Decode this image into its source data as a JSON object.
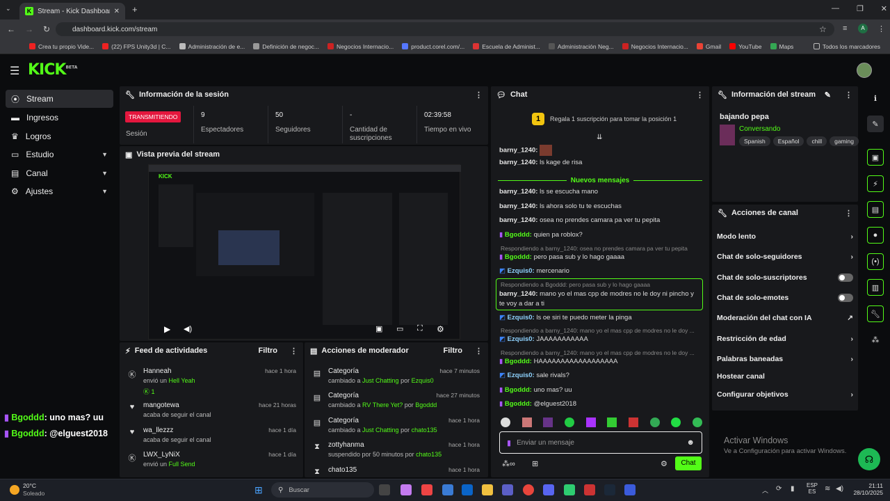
{
  "browser": {
    "tab_title": "Stream - Kick Dashboard",
    "url": "dashboard.kick.com/stream",
    "bookmarks": [
      "Crea tu propio Vide...",
      "(22) FPS Unity3d | C...",
      "Administración de e...",
      "Definición de negoc...",
      "Negocios Internacio...",
      "product.corel.com/...",
      "Escuela de Administ...",
      "Administración Neg...",
      "Negocios Internacio...",
      "Gmail",
      "YouTube",
      "Maps"
    ],
    "all_bookmarks": "Todos los marcadores",
    "profile_initial": "A"
  },
  "app": {
    "logo": "KICK",
    "logo_badge": "BETA"
  },
  "nav": [
    {
      "label": "Stream",
      "icon": "stream-icon",
      "active": true
    },
    {
      "label": "Ingresos",
      "icon": "money-icon"
    },
    {
      "label": "Logros",
      "icon": "trophy-icon"
    },
    {
      "label": "Estudio",
      "icon": "studio-icon",
      "expandable": true
    },
    {
      "label": "Canal",
      "icon": "channel-icon",
      "expandable": true
    },
    {
      "label": "Ajustes",
      "icon": "gear-icon",
      "expandable": true
    }
  ],
  "overlay_chat": [
    {
      "user": "Bgoddd",
      "text": ": uno mas? uu"
    },
    {
      "user": "Bgoddd",
      "text": ": @elguest2018"
    }
  ],
  "session": {
    "title": "Información de la sesión",
    "status_badge": "TRANSMITIENDO",
    "status_label": "Sesión",
    "stats": [
      {
        "value": "9",
        "label": "Espectadores"
      },
      {
        "value": "50",
        "label": "Seguidores"
      },
      {
        "value": "-",
        "label": "Cantidad de suscripciones"
      },
      {
        "value": "02:39:58",
        "label": "Tiempo en vivo"
      }
    ]
  },
  "preview": {
    "title": "Vista previa del stream"
  },
  "feed": {
    "title": "Feed de actividades",
    "filter": "Filtro",
    "items": [
      {
        "name": "Hanneah",
        "sub_pre": "envió un ",
        "sub_hl": "Hell Yeah",
        "extra": "1",
        "time": "hace 1 hora",
        "icon": "kick-coin-icon"
      },
      {
        "name": "mangotewa",
        "sub_pre": "acaba de seguir el canal",
        "sub_hl": "",
        "time": "hace 21 horas",
        "icon": "heart-icon"
      },
      {
        "name": "wa_llezzz",
        "sub_pre": "acaba de seguir el canal",
        "sub_hl": "",
        "time": "hace 1 día",
        "icon": "heart-icon"
      },
      {
        "name": "LWX_LyNiX",
        "sub_pre": "envió un ",
        "sub_hl": "Full Send",
        "time": "hace 1 día",
        "icon": "kick-coin-icon"
      }
    ]
  },
  "modactions": {
    "title": "Acciones de moderador",
    "filter": "Filtro",
    "items": [
      {
        "name": "Categoría",
        "pre": "cambiado a ",
        "hl": "Just Chatting",
        "mid": " por ",
        "by": "Ezquis0",
        "time": "hace 7 minutos"
      },
      {
        "name": "Categoría",
        "pre": "cambiado a ",
        "hl": "RV There Yet?",
        "mid": " por ",
        "by": "Bgoddd",
        "time": "hace 27 minutos"
      },
      {
        "name": "Categoría",
        "pre": "cambiado a ",
        "hl": "Just Chatting",
        "mid": " por ",
        "by": "chato135",
        "time": "hace 1 hora"
      },
      {
        "name": "zottyhanma",
        "pre": "suspendido por 50 minutos por ",
        "hl": "",
        "mid": "",
        "by": "chato135",
        "time": "hace 1 hora"
      },
      {
        "name": "chato135",
        "pre": "",
        "hl": "",
        "mid": "",
        "by": "",
        "time": "hace 1 hora"
      }
    ]
  },
  "chat": {
    "title": "Chat",
    "pinned_badge": "1",
    "pinned_text": "Regala 1 suscripción para tomar la posición 1",
    "new_messages": "Nuevos mensajes",
    "placeholder": "Enviar un mensaje",
    "send": "Chat",
    "messages": [
      {
        "user": "barny_1240:",
        "text": "",
        "green": false
      },
      {
        "user": "barny_1240:",
        "text": "ls kage de risa",
        "green": false
      },
      {
        "user": "barny_1240:",
        "text": "ls se escucha mano",
        "green": false
      },
      {
        "user": "barny_1240:",
        "text": "ls ahora solo tu te escuchas",
        "green": false
      },
      {
        "user": "barny_1240:",
        "text": "osea no prendes camara pa ver tu pepita",
        "green": false
      },
      {
        "user": "Bgoddd:",
        "text": "quien pa roblox?",
        "green": true
      },
      {
        "user": "Bgoddd:",
        "text": "pero pasa sub y lo hago gaaaa",
        "green": true
      },
      {
        "user": "Ezquis0:",
        "text": "mercenario",
        "green": false
      },
      {
        "user": "barny_1240:",
        "text": "mano yo el mas cpp de modres no le doy ni pincho y te voy a dar a ti",
        "green": false
      },
      {
        "user": "Ezquis0:",
        "text": "ls oe siri te puedo meter la pinga",
        "green": false
      },
      {
        "user": "Ezquis0:",
        "text": "JAAAAAAAAAAA",
        "green": false
      },
      {
        "user": "Bgoddd:",
        "text": "HAAAAAAAAAAAAAAAAAA",
        "green": true
      },
      {
        "user": "Ezquis0:",
        "text": "sale rivals?",
        "green": false
      },
      {
        "user": "Bgoddd:",
        "text": "uno mas? uu",
        "green": true
      },
      {
        "user": "Bgoddd:",
        "text": "@elguest2018",
        "green": true
      }
    ],
    "replies": [
      "Respondiendo a barny_1240: osea no prendes camara pa ver tu pepita",
      "Respondiendo a Bgoddd: pero pasa sub y lo hago gaaaa",
      "Respondiendo a barny_1240: mano yo el mas cpp de modres no le doy ...",
      "Respondiendo a barny_1240: mano yo el mas cpp de modres no le doy ..."
    ]
  },
  "stream_info": {
    "title": "Información del stream",
    "stream_title": "bajando pepa",
    "category": "Conversando",
    "tags": [
      "Spanish",
      "Español",
      "chill",
      "gaming"
    ]
  },
  "channel_actions": {
    "title": "Acciones de canal",
    "items": [
      {
        "label": "Modo lento",
        "kind": "chevron"
      },
      {
        "label": "Chat de solo-seguidores",
        "kind": "chevron"
      },
      {
        "label": "Chat de solo-suscriptores",
        "kind": "toggle"
      },
      {
        "label": "Chat de solo-emotes",
        "kind": "toggle"
      },
      {
        "label": "Moderación del chat con IA",
        "kind": "external"
      },
      {
        "label": "Restricción de edad",
        "kind": "chevron"
      },
      {
        "label": "Palabras baneadas",
        "kind": "chevron"
      },
      {
        "label": "Hostear canal",
        "kind": "none"
      },
      {
        "label": "Configurar objetivos",
        "kind": "chevron"
      }
    ]
  },
  "windows": {
    "activate_title": "Activar Windows",
    "activate_sub": "Ve a Configuración para activar Windows.",
    "weather_temp": "20°C",
    "weather_desc": "Soleado",
    "search": "Buscar",
    "lang1": "ESP",
    "lang2": "ES",
    "time": "21:11",
    "date": "28/10/2025"
  },
  "colors": {
    "accent": "#53fc18",
    "live": "#e4173e",
    "panel": "#18191c"
  }
}
